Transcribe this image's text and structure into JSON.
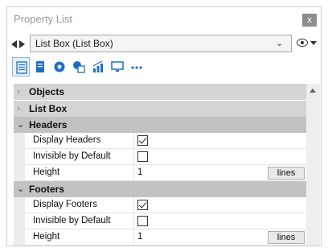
{
  "window": {
    "title": "Property List",
    "close_label": "x"
  },
  "object_selector": {
    "value": "List Box (List Box)"
  },
  "toolbar": {
    "tabs": [
      {
        "icon": "property-list-icon",
        "active": true
      },
      {
        "icon": "document-icon",
        "active": false
      },
      {
        "icon": "settings-gear-icon",
        "active": false
      },
      {
        "icon": "shapes-icon",
        "active": false
      },
      {
        "icon": "chart-icon",
        "active": false
      },
      {
        "icon": "monitor-icon",
        "active": false
      },
      {
        "icon": "more-icon",
        "label": "..."
      }
    ]
  },
  "properties": {
    "categories": {
      "objects": {
        "label": "Objects",
        "expanded": false
      },
      "list_box": {
        "label": "List Box",
        "expanded": false
      },
      "headers": {
        "label": "Headers",
        "expanded": true
      },
      "footers": {
        "label": "Footers",
        "expanded": true
      }
    },
    "headers": {
      "display_headers": {
        "label": "Display Headers",
        "checked": true
      },
      "invisible_by_default": {
        "label": "Invisible by Default",
        "checked": false
      },
      "height": {
        "label": "Height",
        "value": "1",
        "unit": "lines"
      }
    },
    "footers": {
      "display_footers": {
        "label": "Display Footers",
        "checked": true
      },
      "invisible_by_default": {
        "label": "Invisible by Default",
        "checked": false
      },
      "height": {
        "label": "Height",
        "value": "1",
        "unit": "lines"
      }
    }
  },
  "colors": {
    "category_collapsed": "#d4d4d4",
    "category_expanded": "#c2c2c2",
    "toolbar_icon": "#1f6fbf",
    "active_tab_border": "#8ab4d8"
  }
}
